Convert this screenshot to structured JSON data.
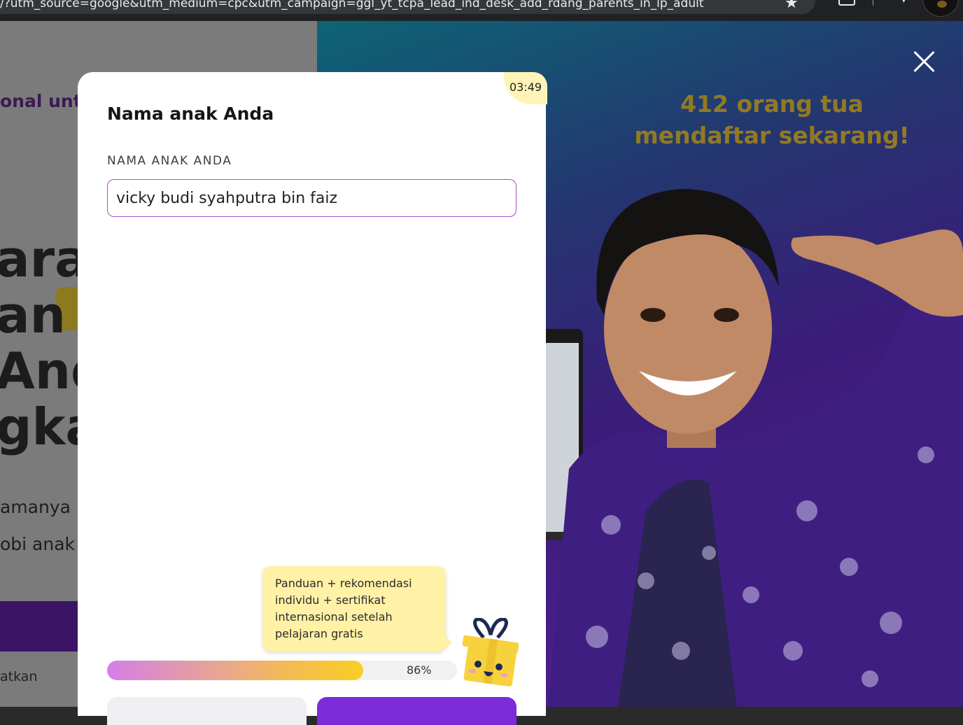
{
  "browser": {
    "url_fragment": "/?utm_source=google&utm_medium=cpc&utm_campaign=ggl_yt_tcpa_lead_ind_desk_add_rdang_parents_in_lp_adult",
    "bookmark_icon": "star-icon",
    "tabs_icon": "tab-icon",
    "download_icon": "download-icon",
    "profile_icon": "avatar"
  },
  "background_page": {
    "subtitle_fragment": "onal untu",
    "heading_lines": [
      "arar",
      "an g",
      "And",
      "gkal"
    ],
    "line1": "amanya",
    "line2": "obi anak",
    "bottom_text": "atkan"
  },
  "promo": {
    "counter_text": "412 orang tua mendaftar sekarang!",
    "close_icon": "close-icon",
    "accent_color": "#927a23"
  },
  "modal": {
    "timer": "03:49",
    "title": "Nama anak Anda",
    "field_label": "NAMA ANAK ANDA",
    "name_value": "vicky budi syahputra bin faiz",
    "tooltip_text": "Panduan + rekomendasi individu + sertifikat internasional setelah pelajaran gratis",
    "progress_percent": 86,
    "progress_label": "86%",
    "gift_icon": "gift-icon",
    "next_button_color": "#7c2bd9"
  }
}
